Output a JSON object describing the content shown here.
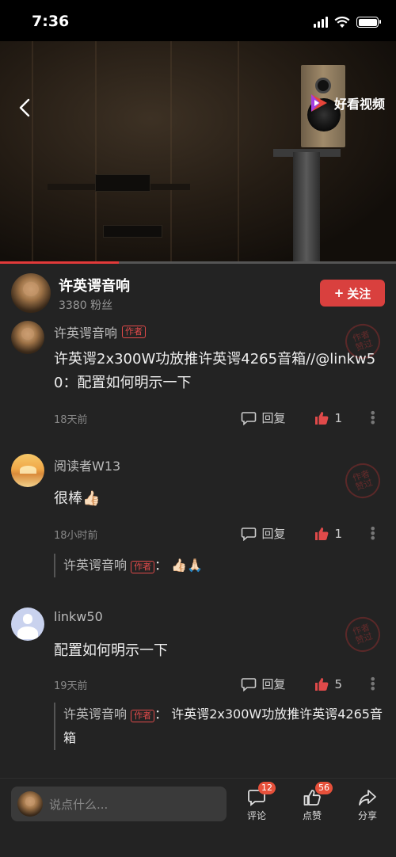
{
  "status": {
    "time": "7:36"
  },
  "video": {
    "brand": "好看视频",
    "progress": 0.3
  },
  "author": {
    "name": "许英谔音响",
    "fans": "3380 粉丝",
    "follow_label": "关注"
  },
  "labels": {
    "author_tag": "作者",
    "reply": "回复",
    "stamp": "作者赞过",
    "colon": "："
  },
  "comments": [
    {
      "name": "许英谔音响",
      "is_author": true,
      "text": "许英谔2x300W功放推许英谔4265音箱//@linkw50：配置如何明示一下",
      "time": "18天前",
      "likes": "1"
    },
    {
      "name": "阅读者W13",
      "is_author": false,
      "text": "很棒👍🏻",
      "time": "18小时前",
      "likes": "1",
      "reply": {
        "name": "许英谔音响",
        "text": "👍🏻🙏🏻"
      }
    },
    {
      "name": "linkw50",
      "is_author": false,
      "text": "配置如何明示一下",
      "time": "19天前",
      "likes": "5",
      "reply": {
        "name": "许英谔音响",
        "text": "许英谔2x300W功放推许英谔4265音箱"
      }
    }
  ],
  "bottom": {
    "placeholder": "说点什么...",
    "comment_label": "评论",
    "comment_count": "12",
    "like_label": "点赞",
    "like_count": "56",
    "share_label": "分享"
  },
  "colors": {
    "accent": "#d9403e",
    "panel": "#232323"
  }
}
